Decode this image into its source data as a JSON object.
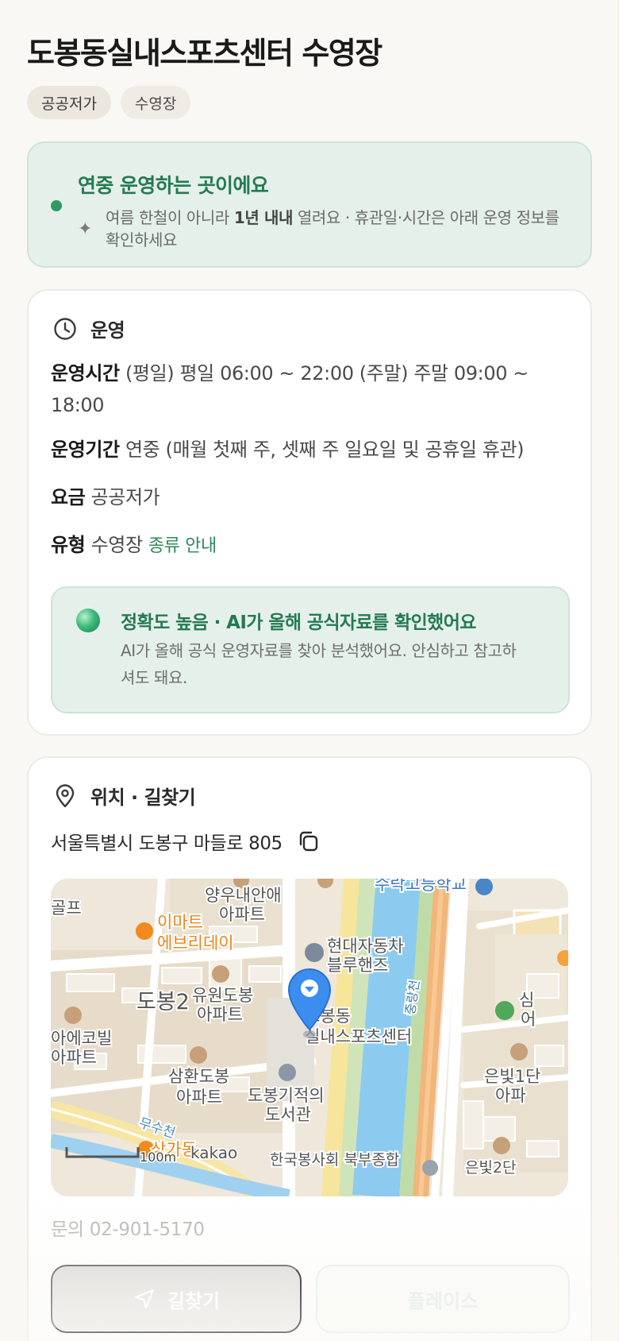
{
  "header": {
    "title": "도봉동실내스포츠센터 수영장",
    "tags": [
      "공공저가",
      "수영장"
    ]
  },
  "banner": {
    "title": "연중 운영하는 곳이에요",
    "desc_pre": "여름 한철이 아니라 ",
    "desc_bold": "1년 내내",
    "desc_post": " 열려요 · 휴관일·시간은 아래 운영 정보를 확인하세요"
  },
  "operation": {
    "section_label": "운영",
    "hours_key": "운영시간",
    "hours_value": "(평일) 평일 06:00 ~ 22:00 (주말) 주말 09:00 ~ 18:00",
    "period_key": "운영기간",
    "period_value": "연중 (매월 첫째 주, 셋째 주 일요일 및 공휴일 휴관)",
    "fee_key": "요금",
    "fee_value": "공공저가",
    "type_key": "유형",
    "type_value": "수영장",
    "type_link": "종류 안내"
  },
  "ai_notice": {
    "title": "정확도 높음 · AI가 올해 공식자료를 확인했어요",
    "desc": "AI가 올해 공식 운영자료를 찾아 분석했어요. 안심하고 참고하셔도 돼요."
  },
  "location": {
    "section_label": "위치 · 길찾기",
    "address": "서울특별시 도봉구 마들로 805",
    "map_labels": {
      "school": "수락고등학교",
      "apt1": "양우내안애",
      "apt1b": "아파트",
      "golf": "골프",
      "emart1": "이마트",
      "emart2": "에브리데이",
      "hyundai1": "현대자동차",
      "hyundai2": "블루핸즈",
      "dobong2": "도봉2",
      "yuwon1": "유원도봉",
      "yuwon2": "아파트",
      "center1": "도봉동",
      "center2": "실내스포츠센터",
      "river": "중랑천",
      "aeco1": "아에코빌",
      "aeco2": "아파트",
      "samhwan1": "삼환도봉",
      "samhwan2": "아파트",
      "library1": "도봉기적의",
      "library2": "도서관",
      "eunbit1": "은빛1단",
      "eunbit1b": "아파",
      "musu": "무수천",
      "sangada": "상가동",
      "scale": "100m",
      "brand": "kakao",
      "welfare": "한국봉사회 북부종합",
      "eunbit2": "은빛2단",
      "sim": "심",
      "o": "어"
    },
    "contact": "문의 02-901-5170",
    "route_button": "길찾기",
    "place_button": "플레이스"
  },
  "colors": {
    "accent": "#247a52",
    "accent_dot": "#2f9a63",
    "pin": "#3b8df0",
    "emart": "#f08a1c"
  }
}
